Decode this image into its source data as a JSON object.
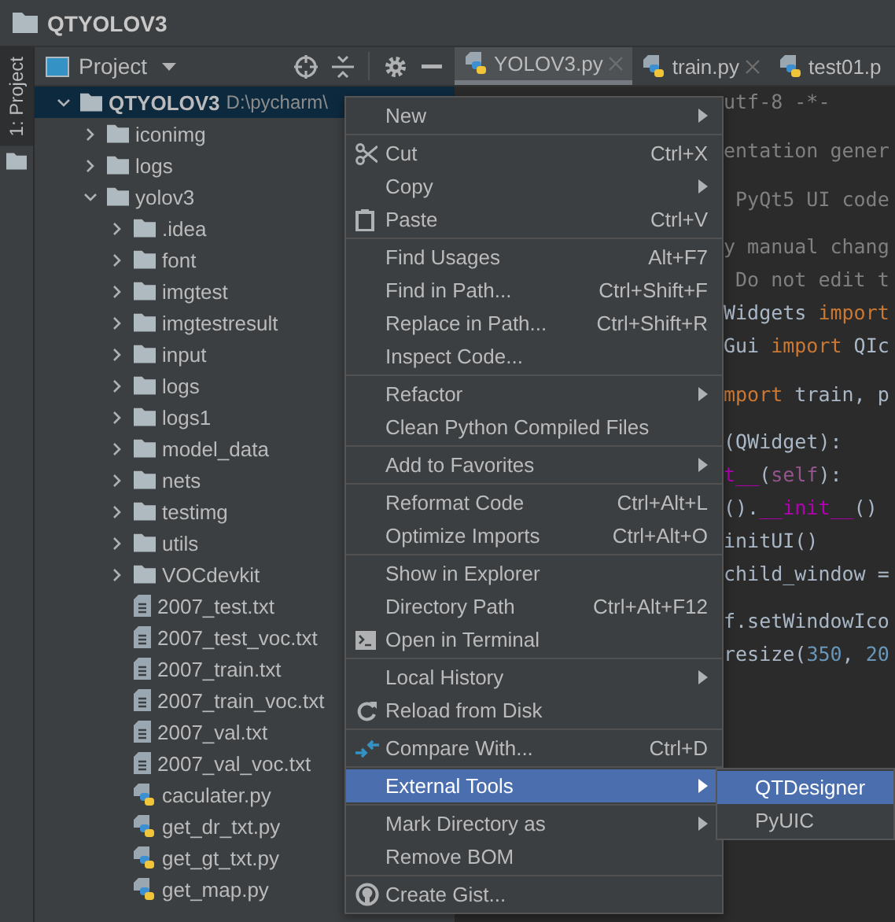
{
  "window": {
    "title": "QTYOLOV3"
  },
  "tool_strip": {
    "tab": {
      "label": "1: Project",
      "selected": true
    }
  },
  "project_panel": {
    "title": "Project",
    "tree": [
      {
        "label": "QTYOLOV3",
        "path": "D:\\pycharm\\",
        "kind": "folder",
        "expanded": true,
        "selected": true,
        "children": [
          {
            "label": "iconimg",
            "kind": "folder",
            "expanded": false,
            "selected": false
          },
          {
            "label": "logs",
            "kind": "folder",
            "expanded": false,
            "selected": false
          },
          {
            "label": "yolov3",
            "kind": "folder",
            "expanded": true,
            "selected": false,
            "children": [
              {
                "label": ".idea",
                "kind": "folder",
                "expanded": false,
                "selected": false
              },
              {
                "label": "font",
                "kind": "folder",
                "expanded": false,
                "selected": false
              },
              {
                "label": "imgtest",
                "kind": "folder",
                "expanded": false,
                "selected": false
              },
              {
                "label": "imgtestresult",
                "kind": "folder",
                "expanded": false,
                "selected": false
              },
              {
                "label": "input",
                "kind": "folder",
                "expanded": false,
                "selected": false
              },
              {
                "label": "logs",
                "kind": "folder",
                "expanded": false,
                "selected": false
              },
              {
                "label": "logs1",
                "kind": "folder",
                "expanded": false,
                "selected": false
              },
              {
                "label": "model_data",
                "kind": "folder",
                "expanded": false,
                "selected": false
              },
              {
                "label": "nets",
                "kind": "folder",
                "expanded": false,
                "selected": false
              },
              {
                "label": "testimg",
                "kind": "folder",
                "expanded": false,
                "selected": false
              },
              {
                "label": "utils",
                "kind": "folder",
                "expanded": false,
                "selected": false
              },
              {
                "label": "VOCdevkit",
                "kind": "folder",
                "expanded": false,
                "selected": false
              },
              {
                "label": "2007_test.txt",
                "kind": "text",
                "selected": false
              },
              {
                "label": "2007_test_voc.txt",
                "kind": "text",
                "selected": false
              },
              {
                "label": "2007_train.txt",
                "kind": "text",
                "selected": false
              },
              {
                "label": "2007_train_voc.txt",
                "kind": "text",
                "selected": false
              },
              {
                "label": "2007_val.txt",
                "kind": "text",
                "selected": false
              },
              {
                "label": "2007_val_voc.txt",
                "kind": "text",
                "selected": false
              },
              {
                "label": "caculater.py",
                "kind": "python",
                "selected": false
              },
              {
                "label": "get_dr_txt.py",
                "kind": "python",
                "selected": false
              },
              {
                "label": "get_gt_txt.py",
                "kind": "python",
                "selected": false
              },
              {
                "label": "get_map.py",
                "kind": "python",
                "selected": false
              }
            ]
          }
        ]
      }
    ]
  },
  "editor": {
    "tabs": [
      {
        "label": "YOLOV3.py",
        "selected": true
      },
      {
        "label": "train.py",
        "selected": false
      },
      {
        "label": "test01.p",
        "selected": false
      }
    ],
    "code_blocks": [
      [
        [
          {
            "t": "utf-8 -*-",
            "kind": "comment"
          }
        ]
      ],
      [
        [
          {
            "t": "entation gener",
            "kind": "comment"
          }
        ]
      ],
      [
        [
          {
            "t": " PyQt5 UI code",
            "kind": "comment"
          }
        ]
      ],
      [
        [
          {
            "t": "y manual chang",
            "kind": "comment"
          }
        ],
        [
          {
            "t": " Do not edit t",
            "kind": "comment"
          }
        ],
        [
          {
            "t": "Widgets ",
            "kind": "plain"
          },
          {
            "t": "import",
            "kind": "keyword"
          }
        ],
        [
          {
            "t": "Gui ",
            "kind": "plain"
          },
          {
            "t": "import",
            "kind": "keyword"
          },
          {
            "t": " QIc",
            "kind": "plain"
          }
        ]
      ],
      [
        [
          {
            "t": "mport",
            "kind": "keyword"
          },
          {
            "t": " train, p",
            "kind": "plain"
          }
        ]
      ],
      [
        [
          {
            "t": "(QWidget):",
            "kind": "plain"
          }
        ],
        [
          {
            "t": "t__",
            "kind": "magic"
          },
          {
            "t": "(",
            "kind": "plain"
          },
          {
            "t": "self",
            "kind": "self"
          },
          {
            "t": "):",
            "kind": "plain"
          }
        ],
        [
          {
            "t": "().",
            "kind": "plain"
          },
          {
            "t": "__init__",
            "kind": "magic"
          },
          {
            "t": "()",
            "kind": "plain"
          }
        ],
        [
          {
            "t": "initUI()",
            "kind": "plain"
          }
        ],
        [
          {
            "t": "child_window =",
            "kind": "plain"
          }
        ]
      ],
      [
        [
          {
            "t": "f.setWindowIco",
            "kind": "plain"
          }
        ],
        [
          {
            "t": "resize(",
            "kind": "plain"
          },
          {
            "t": "350",
            "kind": "number"
          },
          {
            "t": ", ",
            "kind": "plain"
          },
          {
            "t": "20",
            "kind": "number"
          }
        ]
      ]
    ]
  },
  "context_menu": {
    "groups": [
      [
        {
          "label": "New",
          "submenu": true,
          "selected": false
        }
      ],
      [
        {
          "label": "Cut",
          "shortcut": "Ctrl+X",
          "selected": false
        },
        {
          "label": "Copy",
          "submenu": true,
          "selected": false
        },
        {
          "label": "Paste",
          "shortcut": "Ctrl+V",
          "selected": false
        }
      ],
      [
        {
          "label": "Find Usages",
          "shortcut": "Alt+F7",
          "selected": false
        },
        {
          "label": "Find in Path...",
          "shortcut": "Ctrl+Shift+F",
          "selected": false
        },
        {
          "label": "Replace in Path...",
          "shortcut": "Ctrl+Shift+R",
          "selected": false
        },
        {
          "label": "Inspect Code...",
          "selected": false
        }
      ],
      [
        {
          "label": "Refactor",
          "submenu": true,
          "selected": false
        },
        {
          "label": "Clean Python Compiled Files",
          "selected": false
        }
      ],
      [
        {
          "label": "Add to Favorites",
          "submenu": true,
          "selected": false
        }
      ],
      [
        {
          "label": "Reformat Code",
          "shortcut": "Ctrl+Alt+L",
          "selected": false
        },
        {
          "label": "Optimize Imports",
          "shortcut": "Ctrl+Alt+O",
          "selected": false
        }
      ],
      [
        {
          "label": "Show in Explorer",
          "selected": false
        },
        {
          "label": "Directory Path",
          "shortcut": "Ctrl+Alt+F12",
          "selected": false
        },
        {
          "label": "Open in Terminal",
          "selected": false
        }
      ],
      [
        {
          "label": "Local History",
          "submenu": true,
          "selected": false
        },
        {
          "label": "Reload from Disk",
          "selected": false
        }
      ],
      [
        {
          "label": "Compare With...",
          "shortcut": "Ctrl+D",
          "selected": false
        }
      ],
      [
        {
          "label": "External Tools",
          "submenu": true,
          "selected": true
        }
      ],
      [
        {
          "label": "Mark Directory as",
          "submenu": true,
          "selected": false
        },
        {
          "label": "Remove BOM",
          "selected": false
        }
      ],
      [
        {
          "label": "Create Gist...",
          "selected": false
        }
      ]
    ]
  },
  "submenu": {
    "items": [
      {
        "label": "QTDesigner",
        "selected": true
      },
      {
        "label": "PyUIC",
        "selected": false
      }
    ]
  }
}
